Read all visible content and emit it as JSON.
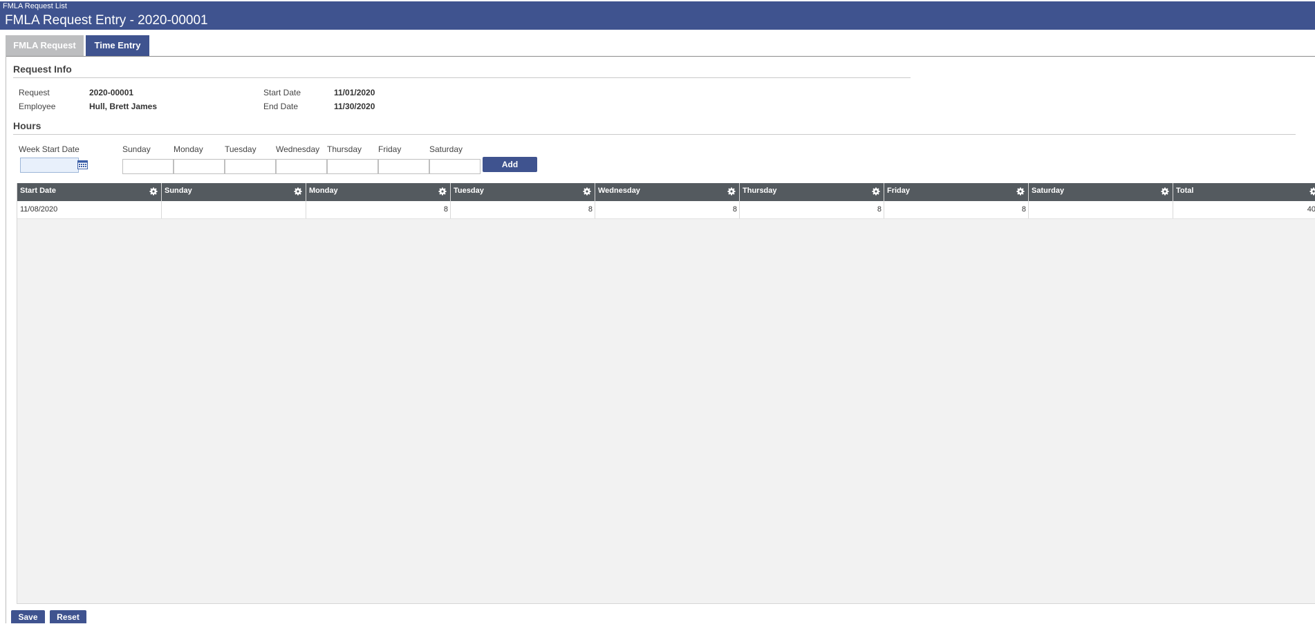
{
  "header": {
    "breadcrumb": "FMLA Request List",
    "title": "FMLA Request Entry - 2020-00001"
  },
  "tabs": [
    {
      "label": "FMLA Request",
      "active": false
    },
    {
      "label": "Time Entry",
      "active": true
    }
  ],
  "request_info": {
    "section_title": "Request Info",
    "request_label": "Request",
    "request_value": "2020-00001",
    "employee_label": "Employee",
    "employee_value": "Hull, Brett James",
    "start_date_label": "Start Date",
    "start_date_value": "11/01/2020",
    "end_date_label": "End Date",
    "end_date_value": "11/30/2020"
  },
  "hours": {
    "section_title": "Hours",
    "week_start_label": "Week Start Date",
    "week_start_value": "",
    "day_labels": [
      "Sunday",
      "Monday",
      "Tuesday",
      "Wednesday",
      "Thursday",
      "Friday",
      "Saturday"
    ],
    "day_values": [
      "",
      "",
      "",
      "",
      "",
      "",
      ""
    ],
    "add_label": "Add"
  },
  "grid": {
    "columns": [
      "Start Date",
      "Sunday",
      "Monday",
      "Tuesday",
      "Wednesday",
      "Thursday",
      "Friday",
      "Saturday",
      "Total"
    ],
    "rows": [
      [
        "11/08/2020",
        "",
        "8",
        "8",
        "8",
        "8",
        "8",
        "",
        "40"
      ]
    ]
  },
  "footer": {
    "save_label": "Save",
    "reset_label": "Reset"
  },
  "colors": {
    "brand": "#3f538f",
    "grid_header": "#545a5f",
    "inactive_tab": "#bdbec0"
  },
  "icons": {
    "calendar": "calendar-icon",
    "column_settings": "gear-icon"
  }
}
